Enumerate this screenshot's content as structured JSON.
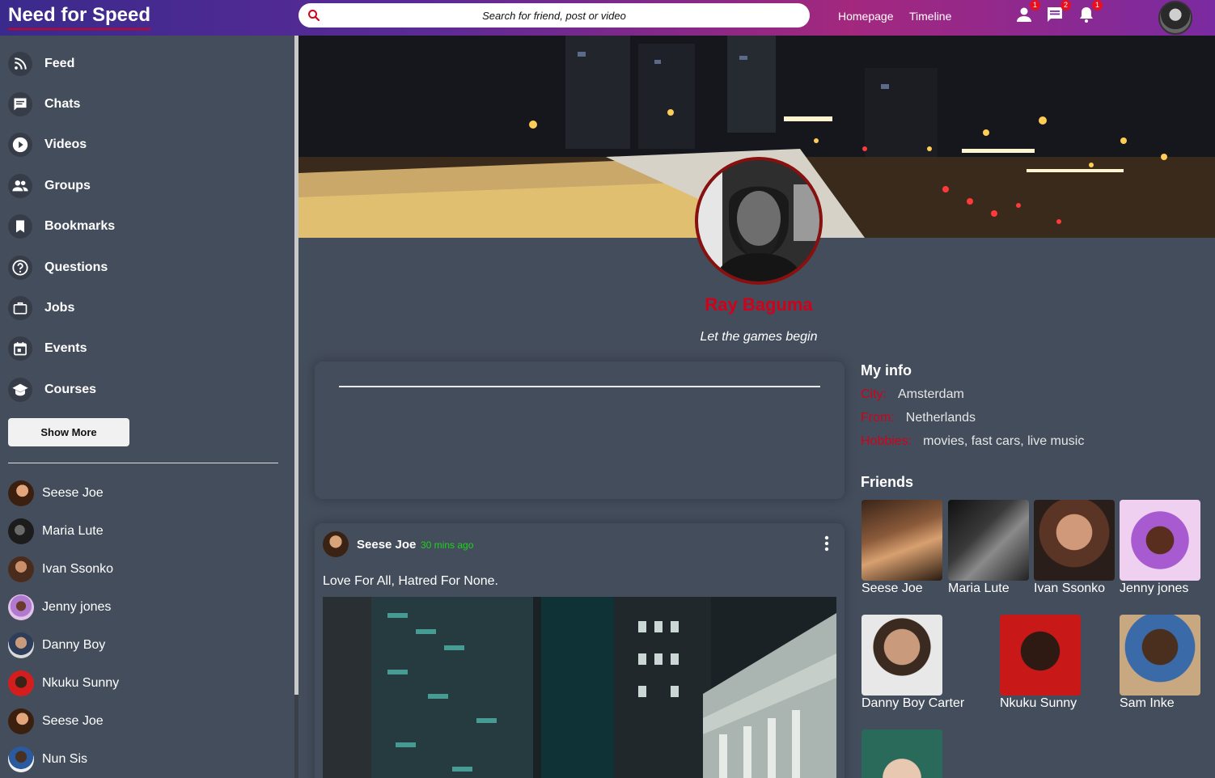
{
  "app": {
    "title": "Need for Speed"
  },
  "search": {
    "placeholder": "Search for friend, post or video"
  },
  "nav": {
    "homepage": "Homepage",
    "timeline": "Timeline"
  },
  "notifications": {
    "friends": "1",
    "messages": "2",
    "alerts": "1"
  },
  "sidebar": {
    "items": [
      {
        "label": "Feed",
        "icon": "rss-icon"
      },
      {
        "label": "Chats",
        "icon": "chat-icon"
      },
      {
        "label": "Videos",
        "icon": "play-circle-icon"
      },
      {
        "label": "Groups",
        "icon": "group-icon"
      },
      {
        "label": "Bookmarks",
        "icon": "bookmark-icon"
      },
      {
        "label": "Questions",
        "icon": "help-circle-icon"
      },
      {
        "label": "Jobs",
        "icon": "briefcase-icon"
      },
      {
        "label": "Events",
        "icon": "calendar-icon"
      },
      {
        "label": "Courses",
        "icon": "school-icon"
      }
    ],
    "show_more": "Show More",
    "friends": [
      "Seese Joe",
      "Maria Lute",
      "Ivan Ssonko",
      "Jenny jones",
      "Danny Boy",
      "Nkuku Sunny",
      "Seese Joe",
      "Nun Sis"
    ]
  },
  "profile": {
    "name": "Ray Baguma",
    "description": "Let the games begin"
  },
  "post": {
    "user": "Seese Joe",
    "time": "30 mins ago",
    "text": "Love For All, Hatred For None."
  },
  "info": {
    "title": "My info",
    "rows": [
      {
        "key": "City:",
        "value": "Amsterdam"
      },
      {
        "key": "From:",
        "value": "Netherlands"
      },
      {
        "key": "Hobbies:",
        "value": "movies, fast cars, live music"
      }
    ]
  },
  "friends": {
    "title": "Friends",
    "list": [
      "Seese Joe",
      "Maria Lute",
      "Ivan Ssonko",
      "Jenny jones",
      "Danny Boy Carter",
      "Nkuku Sunny",
      "Sam Inke"
    ]
  },
  "colors": {
    "accent": "#d0021b",
    "time": "#1fd11f",
    "background": "#444d5c"
  }
}
